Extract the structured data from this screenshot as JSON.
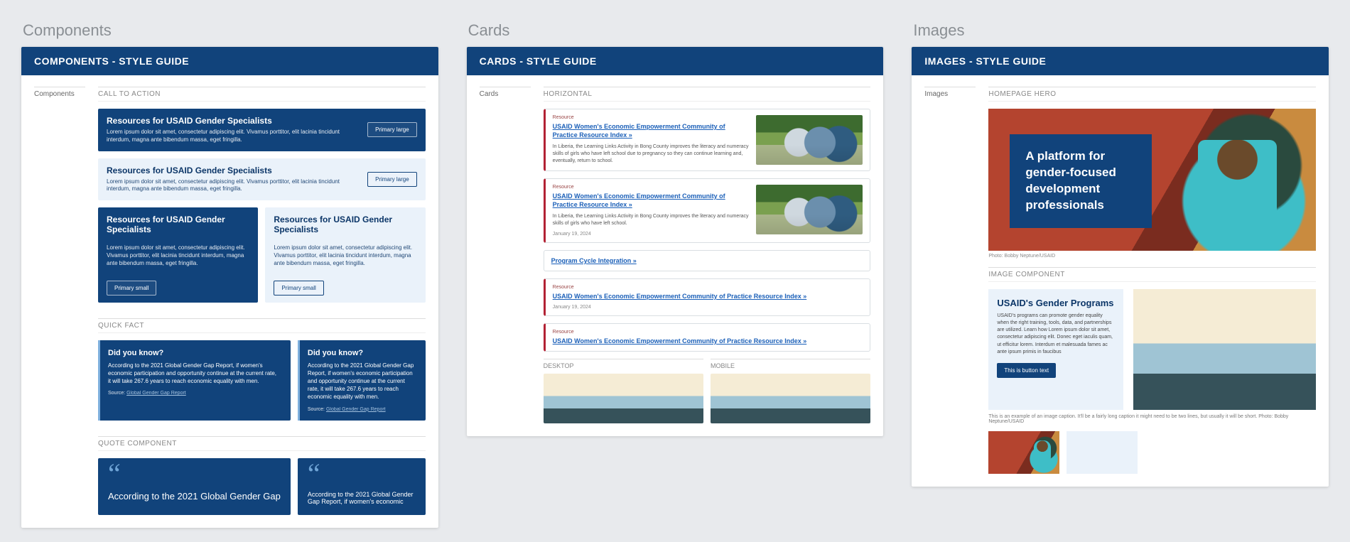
{
  "columns": {
    "components": {
      "label": "Components",
      "header": "COMPONENTS - STYLE GUIDE",
      "side": "Components",
      "sections": {
        "cta": {
          "heading": "CALL TO ACTION",
          "dark": {
            "title": "Resources for USAID Gender Specialists",
            "desc": "Lorem ipsum dolor sit amet, consectetur adipiscing elit. Vivamus porttitor, elit lacinia tincidunt interdum, magna ante bibendum massa, eget fringilla.",
            "btn": "Primary large"
          },
          "light": {
            "title": "Resources for USAID Gender Specialists",
            "desc": "Lorem ipsum dolor sit amet, consectetur adipiscing elit. Vivamus porttitor, elit lacinia tincidunt interdum, magna ante bibendum massa, eget fringilla.",
            "btn": "Primary large"
          },
          "smallDark": {
            "title": "Resources for USAID Gender Specialists",
            "desc": "Lorem ipsum dolor sit amet, consectetur adipiscing elit. Vivamus porttitor, elit lacinia tincidunt interdum, magna ante bibendum massa, eget fringilla.",
            "btn": "Primary small"
          },
          "smallLight": {
            "title": "Resources for USAID Gender Specialists",
            "desc": "Lorem ipsum dolor sit amet, consectetur adipiscing elit. Vivamus porttitor, elit lacinia tincidunt interdum, magna ante bibendum massa, eget fringilla.",
            "btn": "Primary small"
          }
        },
        "quickfact": {
          "heading": "QUICK FACT",
          "wide": {
            "title": "Did you know?",
            "body": "According to the 2021 Global Gender Gap Report, if women's economic participation and opportunity continue at the current rate, it will take 267.6 years to reach economic equality with men.",
            "source_label": "Source:",
            "source_link": "Global Gender Gap Report"
          },
          "narrow": {
            "title": "Did you know?",
            "body": "According to the 2021 Global Gender Gap Report, if women's economic participation and opportunity continue at the current rate, it will take 267.6 years to reach economic equality with men.",
            "source_label": "Source:",
            "source_link": "Global Gender Gap Report"
          }
        },
        "quote": {
          "heading": "QUOTE COMPONENT",
          "big": "According to the 2021 Global Gender Gap",
          "small": "According to the 2021 Global Gender Gap Report, if women's economic"
        }
      }
    },
    "cards": {
      "label": "Cards",
      "header": "CARDS - STYLE GUIDE",
      "side": "Cards",
      "horizontal_heading": "HORIZONTAL",
      "eyebrow": "Resource",
      "card1": {
        "title": "USAID Women's Economic Empowerment Community of Practice Resource Index  »",
        "desc": "In Liberia, the Learning Links Activity in Bong County improves the literacy and numeracy skills of girls who have left school due to pregnancy so they can continue learning and, eventually, return to school."
      },
      "card2": {
        "title": "USAID Women's Economic Empowerment Community of Practice Resource Index  »",
        "desc": "In Liberia, the Learning Links Activity in Bong County improves the literacy and numeracy skills of girls who have left school.",
        "date": "January 19, 2024"
      },
      "card3": {
        "title": "Program Cycle Integration  »"
      },
      "card4": {
        "title": "USAID Women's Economic Empowerment Community of Practice Resource Index  »",
        "date": "January 19, 2024"
      },
      "card5": {
        "title": "USAID Women's Economic Empowerment Community of Practice Resource Index  »"
      },
      "sub_desktop": "DESKTOP",
      "sub_mobile": "MOBILE"
    },
    "images": {
      "label": "Images",
      "header": "IMAGES - STYLE GUIDE",
      "side": "Images",
      "hero_heading": "HOMEPAGE HERO",
      "hero_text": "A platform for gender-focused development professionals",
      "hero_credit": "Photo: Bobby Neptune/USAID",
      "comp_heading": "IMAGE COMPONENT",
      "block_title": "USAID's Gender Programs",
      "block_body": "USAID's programs can promote gender equality when the right training, tools, data, and partnerships are utilized. Learn how Lorem ipsum dolor sit amet, consectetur adipiscing elit. Donec eget iaculis quam, ut efficitur lorem. Interdum et malesuada fames ac ante ipsum primis in faucibus",
      "block_btn": "This is button text",
      "caption": "This is an example of an image caption. It'll be a fairly long caption it might need to be two lines, but usually it will be short. Photo: Bobby Neptune/USAID"
    }
  }
}
